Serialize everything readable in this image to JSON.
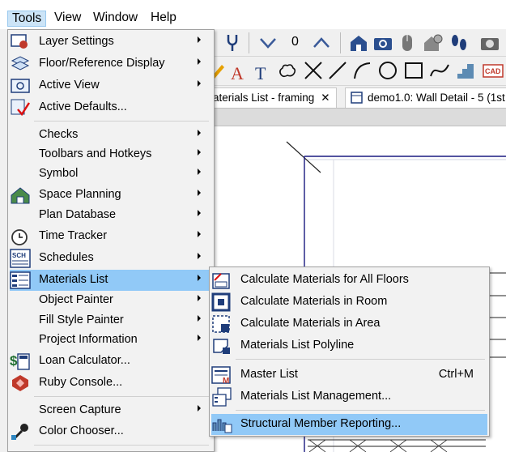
{
  "menubar": [
    "Tools",
    "View",
    "Window",
    "Help"
  ],
  "toolbar": {
    "counter": "0"
  },
  "tabs": [
    {
      "label": "aterials List - framing"
    },
    {
      "label": "demo1.0: Wall Detail - 5 (1st"
    }
  ],
  "tools_menu": {
    "items": [
      {
        "label": "Layer Settings",
        "icon": "layer-settings-icon"
      },
      {
        "label": "Floor/Reference Display",
        "icon": "floor-reference-icon"
      },
      {
        "label": "Active View",
        "icon": "active-view-icon"
      },
      {
        "label": "Active Defaults...",
        "icon": "active-defaults-icon"
      },
      {
        "label": "Checks"
      },
      {
        "label": "Toolbars and Hotkeys"
      },
      {
        "label": "Symbol"
      },
      {
        "label": "Space Planning",
        "icon": "space-planning-icon"
      },
      {
        "label": "Plan Database"
      },
      {
        "label": "Time Tracker",
        "icon": "time-tracker-icon"
      },
      {
        "label": "Schedules",
        "icon": "schedules-icon"
      },
      {
        "label": "Materials List",
        "icon": "materials-list-icon"
      },
      {
        "label": "Object Painter"
      },
      {
        "label": "Fill Style Painter"
      },
      {
        "label": "Project Information"
      },
      {
        "label": "Loan Calculator...",
        "icon": "loan-calculator-icon"
      },
      {
        "label": "Ruby Console...",
        "icon": "ruby-console-icon"
      },
      {
        "label": "Screen Capture"
      },
      {
        "label": "Color Chooser...",
        "icon": "color-chooser-icon"
      }
    ]
  },
  "materials_submenu": {
    "items": [
      {
        "label": "Calculate Materials for All Floors",
        "icon": "calc-all-floors-icon",
        "shortcut": ""
      },
      {
        "label": "Calculate Materials in Room",
        "icon": "calc-room-icon",
        "shortcut": ""
      },
      {
        "label": "Calculate Materials in Area",
        "icon": "calc-area-icon",
        "shortcut": ""
      },
      {
        "label": "Materials List Polyline",
        "icon": "materials-polyline-icon",
        "shortcut": ""
      },
      {
        "label": "Master List",
        "icon": "master-list-icon",
        "shortcut": "Ctrl+M"
      },
      {
        "label": "Materials List Management...",
        "icon": "materials-management-icon",
        "shortcut": ""
      },
      {
        "label": "Structural Member Reporting...",
        "icon": "structural-reporting-icon",
        "shortcut": ""
      }
    ]
  },
  "colors": {
    "highlight": "#91c9f7",
    "menu_bg": "#f2f2f2",
    "plan_line": "#1a1a80"
  }
}
